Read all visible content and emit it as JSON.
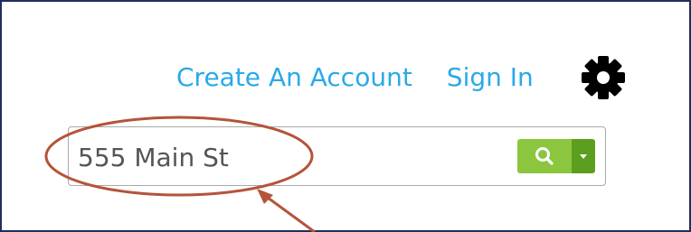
{
  "header": {
    "create_account_label": "Create An Account",
    "sign_in_label": "Sign In",
    "settings_icon": "gear-icon"
  },
  "search": {
    "value": "555 Main St",
    "search_icon": "search-icon",
    "dropdown_icon": "caret-down-icon"
  },
  "colors": {
    "link": "#2aa9e8",
    "search_button": "#8cc63f",
    "dropdown_button": "#5c9e1d",
    "annotation": "#b5533c",
    "frame_border": "#1f2f5c"
  }
}
